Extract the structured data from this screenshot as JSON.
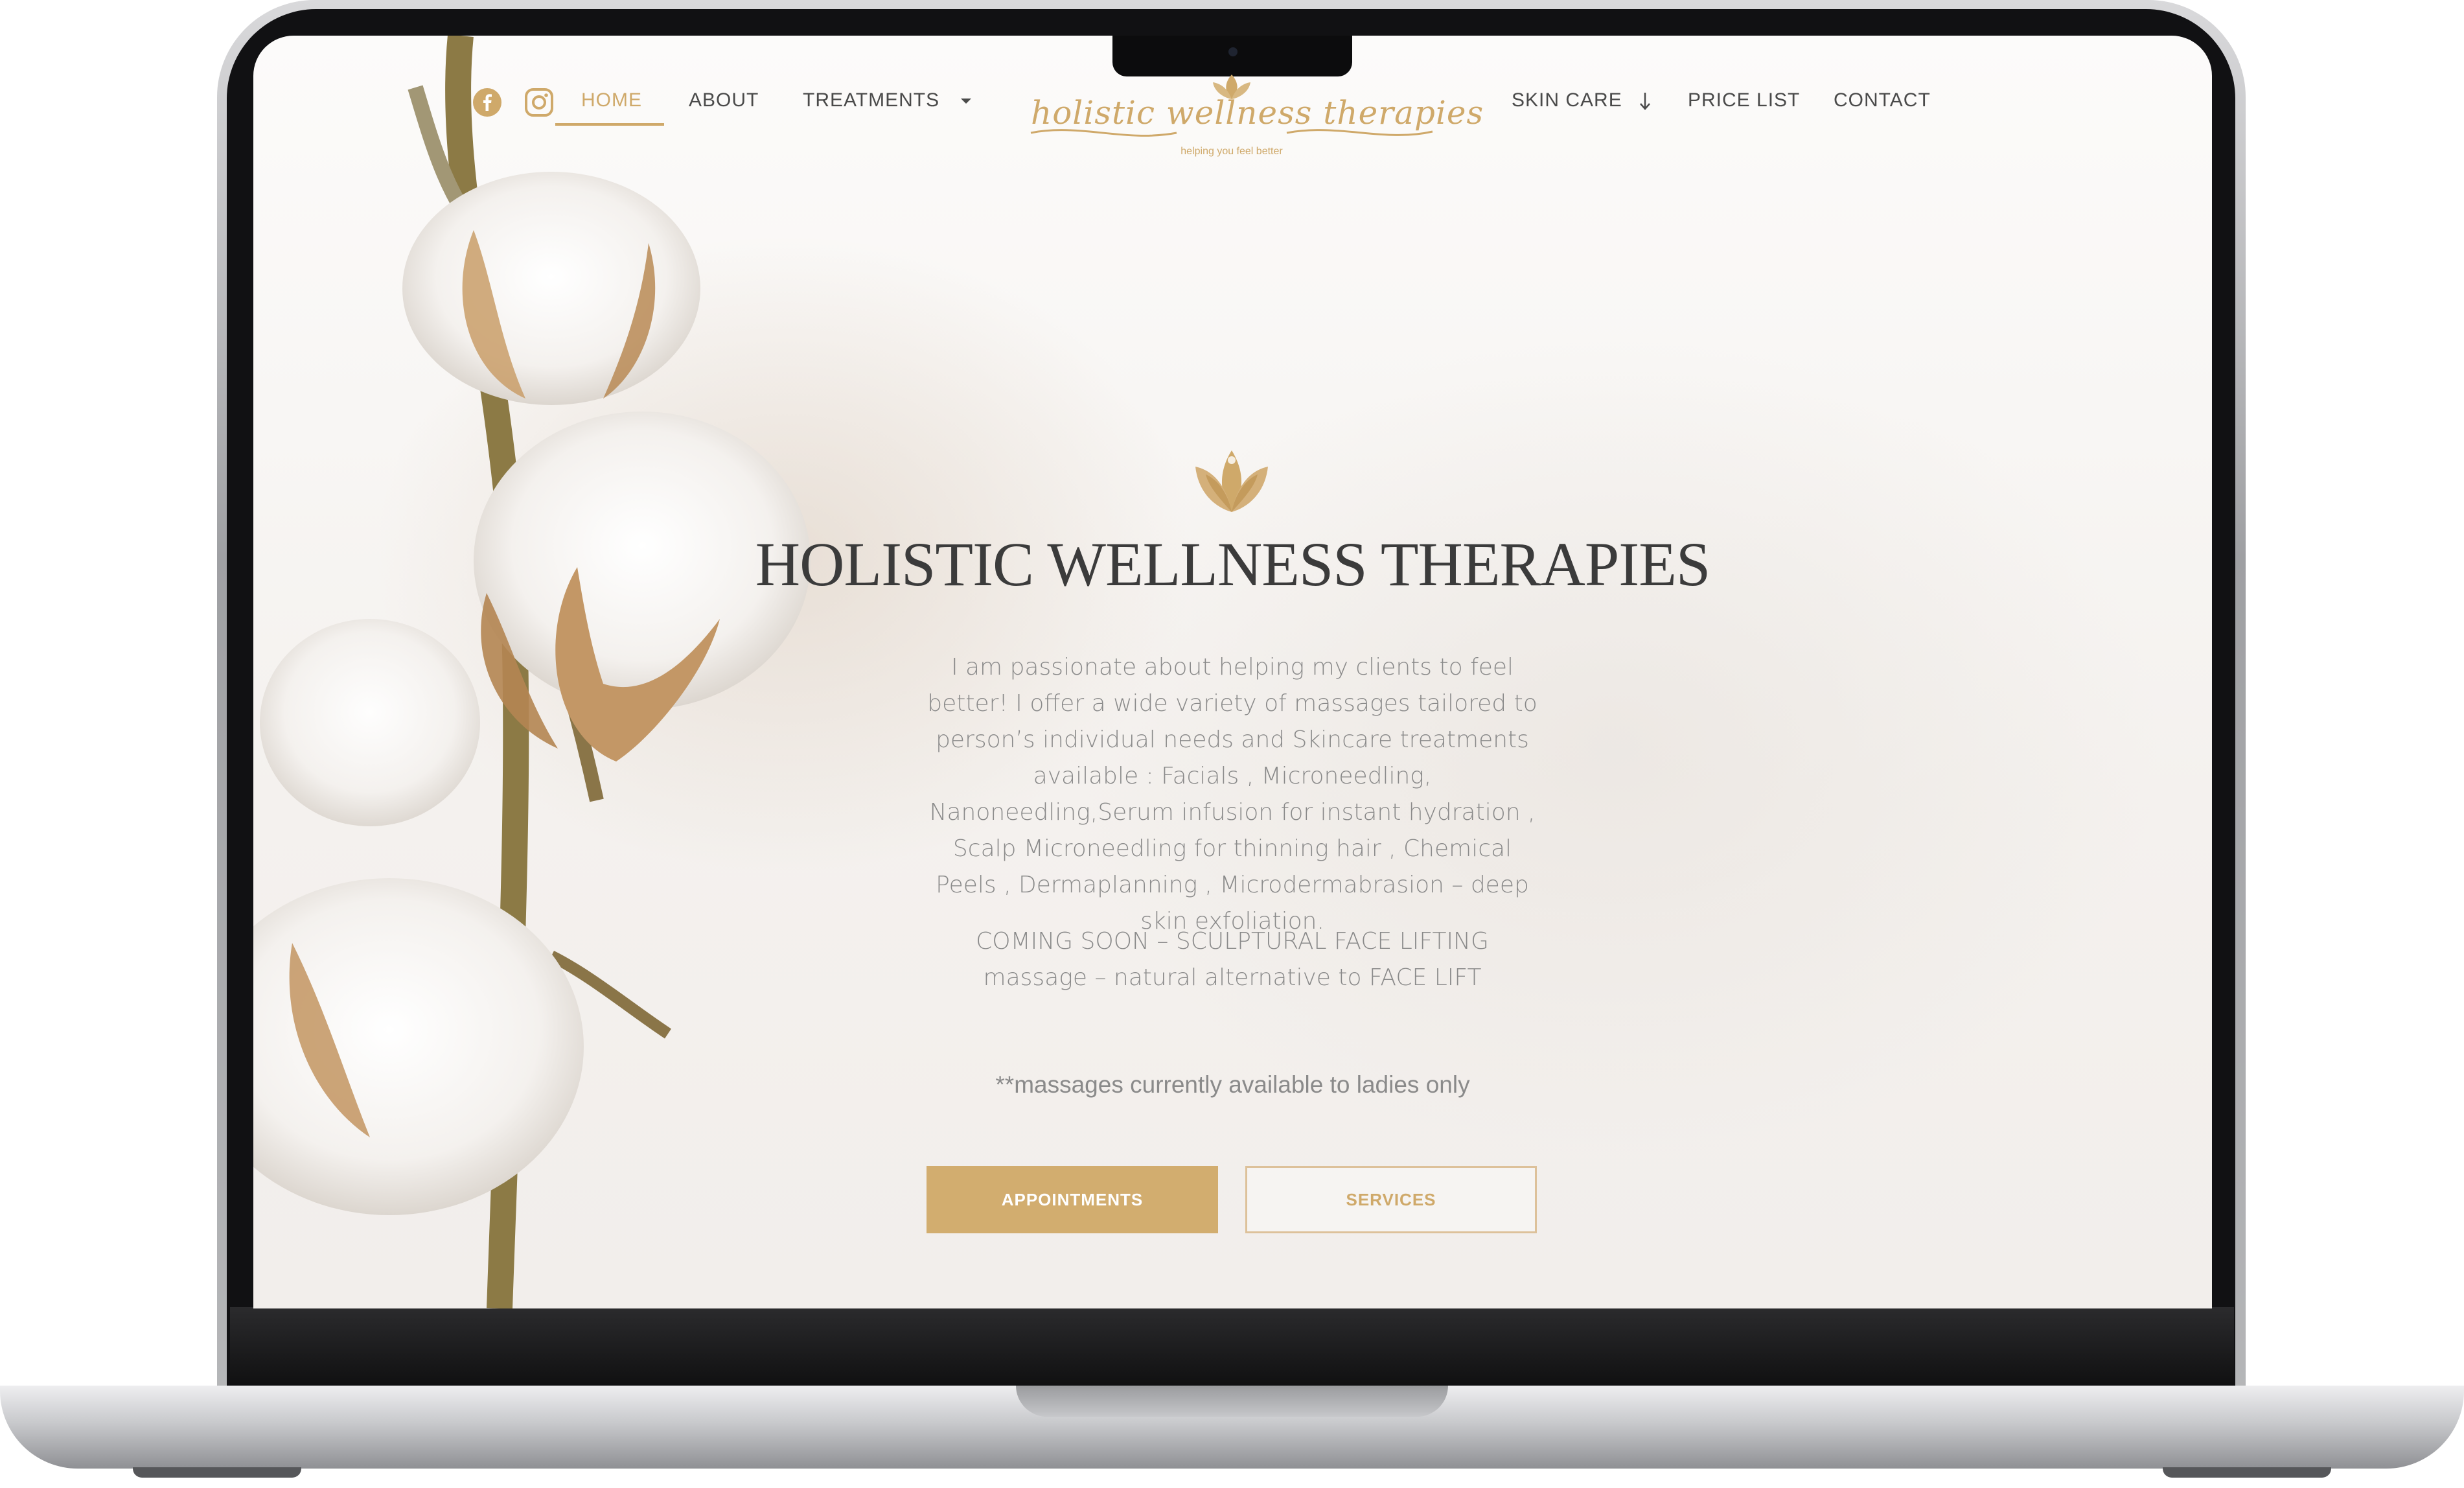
{
  "colors": {
    "accent": "#cfa96a",
    "text_dark": "#3b3b3b",
    "text_muted": "#8a8a8a"
  },
  "nav": {
    "social": [
      {
        "icon": "facebook-icon"
      },
      {
        "icon": "instagram-icon"
      }
    ],
    "items_left": [
      {
        "label": "HOME",
        "active": true
      },
      {
        "label": "ABOUT"
      },
      {
        "label": "TREATMENTS",
        "icon": "caret-down-icon"
      }
    ],
    "items_right": [
      {
        "label": "SKIN CARE",
        "icon": "arrow-down-icon"
      },
      {
        "label": "PRICE LIST"
      },
      {
        "label": "CONTACT"
      }
    ]
  },
  "logo": {
    "name": "holistic wellness therapies",
    "tagline": "helping you feel better"
  },
  "hero": {
    "title": "HOLISTIC WELLNESS THERAPIES",
    "paragraph": "I am passionate about helping my clients to feel better! I offer a wide variety of massages tailored to person’s individual needs and Skincare treatments available : Facials , Microneedling, Nanoneedling,Serum infusion for instant hydration , Scalp Microneedling for thinning hair ,  Chemical Peels , Dermaplanning , Microdermabrasion – deep skin exfoliation.",
    "coming_soon": "COMING SOON – SCULPTURAL FACE LIFTING massage – natural alternative to FACE LIFT",
    "note": "**massages currently available  to ladies only",
    "buttons": {
      "primary": "APPOINTMENTS",
      "secondary": "SERVICES"
    }
  }
}
